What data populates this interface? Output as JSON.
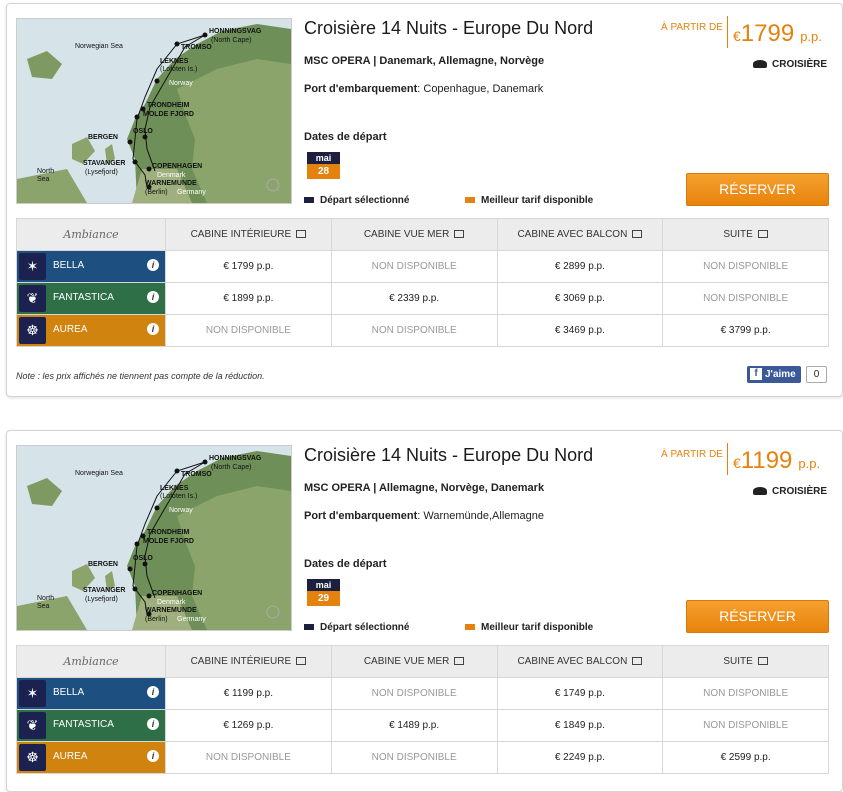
{
  "colors": {
    "accent": "#e5820d",
    "navy": "#1c1f3d",
    "bella": "#1d4f80",
    "fantastica": "#2f6f47",
    "aurea": "#d0830f"
  },
  "map_labels": {
    "norwegian_sea": "Norwegian Sea",
    "north_sea_1": "North",
    "north_sea_2": "Sea",
    "honningsvag": "HONNINGSVAG",
    "north_cape": "(North Cape)",
    "tromso": "TROMSO",
    "leknes": "LEKNES",
    "lofoten": "(Lofoten Is.)",
    "norway": "Norway",
    "trondheim": "TRONDHEIM",
    "molde": "MOLDE FJORD",
    "bergen": "BERGEN",
    "oslo": "OSLO",
    "stavanger": "STAVANGER",
    "lysefjord": "(Lysefjord)",
    "copenhagen": "COPENHAGEN",
    "denmark": "Denmark",
    "warnemunde": "WARNEMUNDE",
    "berlin": "(Berlin)",
    "germany": "Germany"
  },
  "table_headers": {
    "ambiance": "Ambiance",
    "interior": "CABINE INTÉRIEURE",
    "sea_view": "CABINE VUE MER",
    "balcony": "CABINE AVEC BALCON",
    "suite": "SUITE"
  },
  "labels": {
    "from": "À PARTIR DE",
    "currency": "€",
    "pp": "p.p.",
    "type": "CROISIÈRE",
    "reserve": "RÉSERVER",
    "port_label": "Port d'embarquement",
    "dates_label": "Dates de départ",
    "legend_selected": "Départ sélectionné",
    "legend_best": "Meilleur tarif disponible",
    "note": "Note : les prix affichés ne tiennent pas compte de la réduction.",
    "like": "J'aime",
    "like_count": "0",
    "info": "i"
  },
  "cruises": [
    {
      "title": "Croisière 14 Nuits - Europe Du Nord",
      "ship": "MSC OPERA | Danemark, Allemagne, Norvège",
      "port": "Copenhague, Danemark",
      "date_month": "mai",
      "date_day": "28",
      "price": "1799",
      "rows": [
        {
          "name": "BELLA",
          "interior": "€ 1799  p.p.",
          "sea_view": "NON DISPONIBLE",
          "balcony": "€ 2899  p.p.",
          "suite": "NON DISPONIBLE"
        },
        {
          "name": "FANTASTICA",
          "interior": "€ 1899  p.p.",
          "sea_view": "€ 2339  p.p.",
          "balcony": "€ 3069  p.p.",
          "suite": "NON DISPONIBLE"
        },
        {
          "name": "AUREA",
          "interior": "NON DISPONIBLE",
          "sea_view": "NON DISPONIBLE",
          "balcony": "€ 3469  p.p.",
          "suite": "€ 3799  p.p."
        }
      ]
    },
    {
      "title": "Croisière 14 Nuits - Europe Du Nord",
      "ship": "MSC OPERA | Allemagne, Norvège, Danemark",
      "port": "Warnemünde,Allemagne",
      "date_month": "mai",
      "date_day": "29",
      "price": "1199",
      "rows": [
        {
          "name": "BELLA",
          "interior": "€ 1199  p.p.",
          "sea_view": "NON DISPONIBLE",
          "balcony": "€ 1749  p.p.",
          "suite": "NON DISPONIBLE"
        },
        {
          "name": "FANTASTICA",
          "interior": "€ 1269  p.p.",
          "sea_view": "€ 1489  p.p.",
          "balcony": "€ 1849  p.p.",
          "suite": "NON DISPONIBLE"
        },
        {
          "name": "AUREA",
          "interior": "NON DISPONIBLE",
          "sea_view": "NON DISPONIBLE",
          "balcony": "€ 2249  p.p.",
          "suite": "€ 2599  p.p."
        }
      ]
    }
  ]
}
